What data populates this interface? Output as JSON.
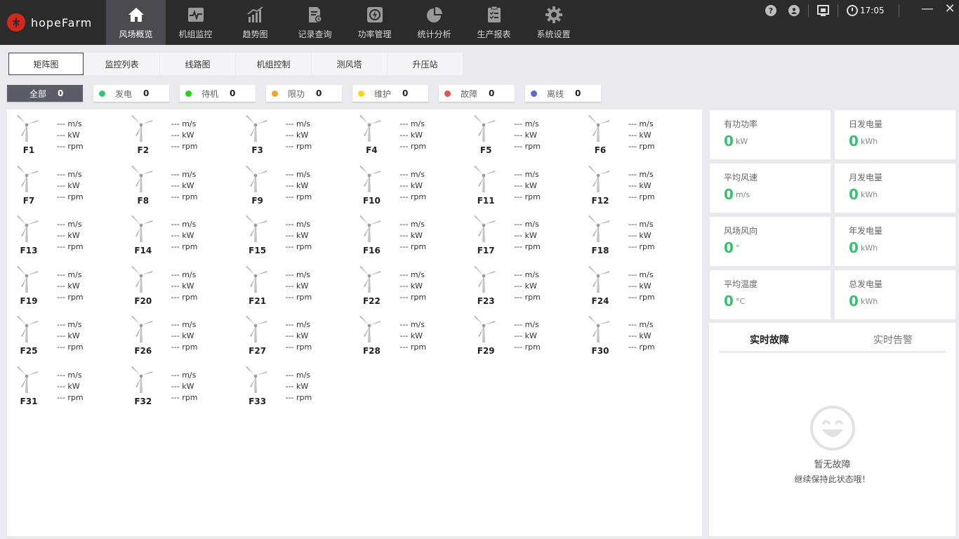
{
  "app": {
    "name": "hopeFarm"
  },
  "nav": [
    {
      "label": "风场概览",
      "icon": "home-icon",
      "active": true
    },
    {
      "label": "机组监控",
      "icon": "monitor-pulse-icon",
      "active": false
    },
    {
      "label": "趋势图",
      "icon": "trend-chart-icon",
      "active": false
    },
    {
      "label": "记录查询",
      "icon": "record-search-icon",
      "active": false
    },
    {
      "label": "功率管理",
      "icon": "power-management-icon",
      "active": false
    },
    {
      "label": "统计分析",
      "icon": "pie-chart-icon",
      "active": false
    },
    {
      "label": "生产报表",
      "icon": "report-icon",
      "active": false
    },
    {
      "label": "系统设置",
      "icon": "gear-icon",
      "active": false
    }
  ],
  "system": {
    "help": "?",
    "time": "17:05"
  },
  "subtabs": [
    {
      "label": "矩阵图",
      "active": true
    },
    {
      "label": "监控列表",
      "active": false
    },
    {
      "label": "线路图",
      "active": false
    },
    {
      "label": "机组控制",
      "active": false
    },
    {
      "label": "测风塔",
      "active": false
    },
    {
      "label": "升压站",
      "active": false
    }
  ],
  "filters": [
    {
      "label": "全部",
      "count": "0",
      "color": "#5c5c69"
    },
    {
      "label": "发电",
      "count": "0",
      "color": "#2ecc71"
    },
    {
      "label": "待机",
      "count": "0",
      "color": "#27d320"
    },
    {
      "label": "限功",
      "count": "0",
      "color": "#f5a623"
    },
    {
      "label": "维护",
      "count": "0",
      "color": "#f8d51a"
    },
    {
      "label": "故障",
      "count": "0",
      "color": "#e5534b"
    },
    {
      "label": "离线",
      "count": "0",
      "color": "#5b6bc8"
    }
  ],
  "turbine_placeholder": "---",
  "units": {
    "speed": "m/s",
    "power": "kW",
    "rotor": "rpm"
  },
  "turbines": [
    {
      "name": "F1"
    },
    {
      "name": "F2"
    },
    {
      "name": "F3"
    },
    {
      "name": "F4"
    },
    {
      "name": "F5"
    },
    {
      "name": "F6"
    },
    {
      "name": "F7"
    },
    {
      "name": "F8"
    },
    {
      "name": "F9"
    },
    {
      "name": "F10"
    },
    {
      "name": "F11"
    },
    {
      "name": "F12"
    },
    {
      "name": "F13"
    },
    {
      "name": "F14"
    },
    {
      "name": "F15"
    },
    {
      "name": "F16"
    },
    {
      "name": "F17"
    },
    {
      "name": "F18"
    },
    {
      "name": "F19"
    },
    {
      "name": "F20"
    },
    {
      "name": "F21"
    },
    {
      "name": "F22"
    },
    {
      "name": "F23"
    },
    {
      "name": "F24"
    },
    {
      "name": "F25"
    },
    {
      "name": "F26"
    },
    {
      "name": "F27"
    },
    {
      "name": "F28"
    },
    {
      "name": "F29"
    },
    {
      "name": "F30"
    },
    {
      "name": "F31"
    },
    {
      "name": "F32"
    },
    {
      "name": "F33"
    }
  ],
  "stats": [
    {
      "label": "有功功率",
      "value": "0",
      "unit": "kW"
    },
    {
      "label": "日发电量",
      "value": "0",
      "unit": "kWh"
    },
    {
      "label": "平均风速",
      "value": "0",
      "unit": "m/s"
    },
    {
      "label": "月发电量",
      "value": "0",
      "unit": "kWh"
    },
    {
      "label": "风场风向",
      "value": "0",
      "unit": "°"
    },
    {
      "label": "年发电量",
      "value": "0",
      "unit": "kWh"
    },
    {
      "label": "平均温度",
      "value": "0",
      "unit": "°C"
    },
    {
      "label": "总发电量",
      "value": "0",
      "unit": "kWh"
    }
  ],
  "alarms": {
    "tab_fault": "实时故障",
    "tab_alert": "实时告警",
    "empty_title": "暂无故障",
    "empty_sub": "继续保持此状态哦！"
  }
}
